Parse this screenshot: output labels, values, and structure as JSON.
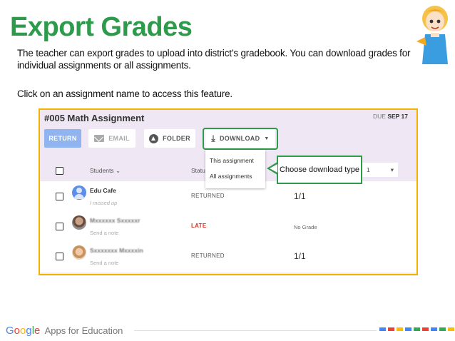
{
  "slide": {
    "title": "Export Grades",
    "intro": "The teacher can export grades to upload into district’s gradebook. You can download grades for individual assignments or all assignments.",
    "instruction": "Click on an assignment name to access this feature."
  },
  "assignment": {
    "title": "#005 Math Assignment",
    "due_prefix": "DUE",
    "due_date": "SEP 17"
  },
  "toolbar": {
    "return_label": "RETURN",
    "email_label": "EMAIL",
    "folder_label": "FOLDER",
    "download_label": "DOWNLOAD"
  },
  "download_menu": {
    "items": [
      "This assignment",
      "All assignments"
    ]
  },
  "callout": {
    "text": "Choose download type"
  },
  "table": {
    "students_header": "Students",
    "status_header": "Statu",
    "grade_select_value": "1",
    "rows": [
      {
        "name": "Edu Cafe",
        "sub": "I missed up",
        "status": "RETURNED",
        "grade": "1/1",
        "avatar": "blue"
      },
      {
        "name": "Mxxxxxx Sxxxxxr",
        "sub": "Send a note",
        "status": "LATE",
        "grade": "No Grade",
        "avatar": "man"
      },
      {
        "name": "Sxxxxxxx Mxxxxin",
        "sub": "Send a note",
        "status": "RETURNED",
        "grade": "1/1",
        "avatar": "woman"
      }
    ]
  },
  "footer": {
    "brand_letters": [
      "G",
      "o",
      "o",
      "g",
      "l",
      "e"
    ],
    "product": "Apps for Education",
    "dot_colors": [
      "#4285f4",
      "#ea4335",
      "#fbbc05",
      "#4285f4",
      "#34a853",
      "#ea4335",
      "#4285f4",
      "#34a853",
      "#fbbc05",
      "#ea4335"
    ]
  },
  "colors": {
    "title_green": "#2e9a4c",
    "frame_border": "#f0b400",
    "return_blue": "#8fb4ef",
    "late_red": "#d93025"
  }
}
